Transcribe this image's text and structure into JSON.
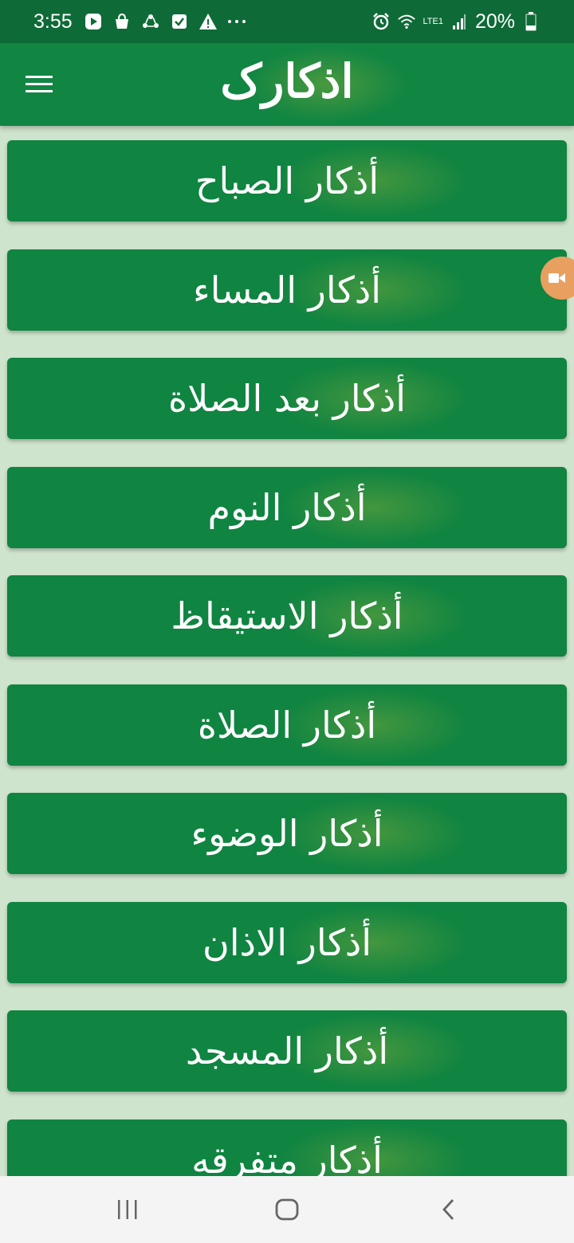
{
  "status_bar": {
    "time": "3:55",
    "battery": "20%",
    "network": "LTE1",
    "icons_left": [
      "play-store-icon",
      "shopping-bag-icon",
      "sync-icon",
      "checkbox-icon",
      "warning-icon",
      "more-dots-icon"
    ],
    "icons_right": [
      "alarm-icon",
      "wifi-icon",
      "signal-icon",
      "battery-icon"
    ]
  },
  "app_bar": {
    "title": "اذکارک",
    "menu_icon": "hamburger-menu-icon"
  },
  "menu_items": [
    {
      "label": "أذكار الصباح"
    },
    {
      "label": "أذكار المساء"
    },
    {
      "label": "أذكار بعد الصلاة"
    },
    {
      "label": "أذكار النوم"
    },
    {
      "label": "أذكار الاستيقاظ"
    },
    {
      "label": "أذكار الصلاة"
    },
    {
      "label": "أذكار الوضوء"
    },
    {
      "label": "أذكار الاذان"
    },
    {
      "label": "أذكار المسجد"
    },
    {
      "label": "أذكار متفرقه"
    }
  ],
  "nav_bar": {
    "recents": "recents-icon",
    "home": "home-icon",
    "back": "back-icon"
  },
  "colors": {
    "status_bar": "#0e6b37",
    "app_bar": "#118542",
    "item": "#108441",
    "background": "#cfe4cd"
  }
}
